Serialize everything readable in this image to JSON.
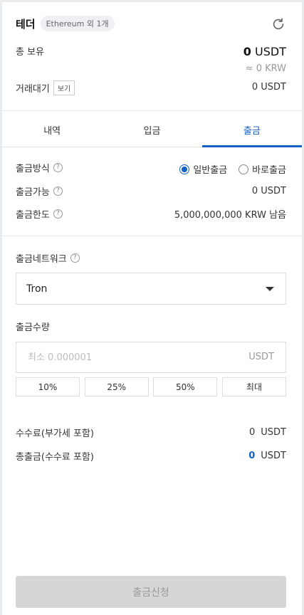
{
  "header": {
    "coin_name": "테더",
    "network_chip": "Ethereum 외 1개"
  },
  "balance": {
    "total_label": "총 보유",
    "total_value": "0",
    "total_unit": "USDT",
    "krw_value": "≈ 0 KRW",
    "pending_label": "거래대기",
    "view_label": "보기",
    "pending_value": "0 USDT"
  },
  "tabs": [
    {
      "label": "내역"
    },
    {
      "label": "입금"
    },
    {
      "label": "출금"
    }
  ],
  "withdraw": {
    "method_label": "출금방식",
    "method_options": [
      "일반출금",
      "바로출금"
    ],
    "available_label": "출금가능",
    "available_value": "0 USDT",
    "limit_label": "출금한도",
    "limit_value": "5,000,000,000 KRW 남음",
    "network_label": "출금네트워크",
    "network_selected": "Tron",
    "amount_label": "출금수량",
    "amount_placeholder": "최소 0.000001",
    "amount_unit": "USDT",
    "percent_buttons": [
      "10%",
      "25%",
      "50%",
      "최대"
    ],
    "fee_label": "수수료(부가세 포함)",
    "fee_value": "0",
    "fee_unit": "USDT",
    "total_label": "총출금(수수료 포함)",
    "total_value": "0",
    "total_unit": "USDT",
    "submit_label": "출금신청"
  },
  "colors": {
    "accent": "#1261c4",
    "disabled_button": "#d5d6d8"
  }
}
